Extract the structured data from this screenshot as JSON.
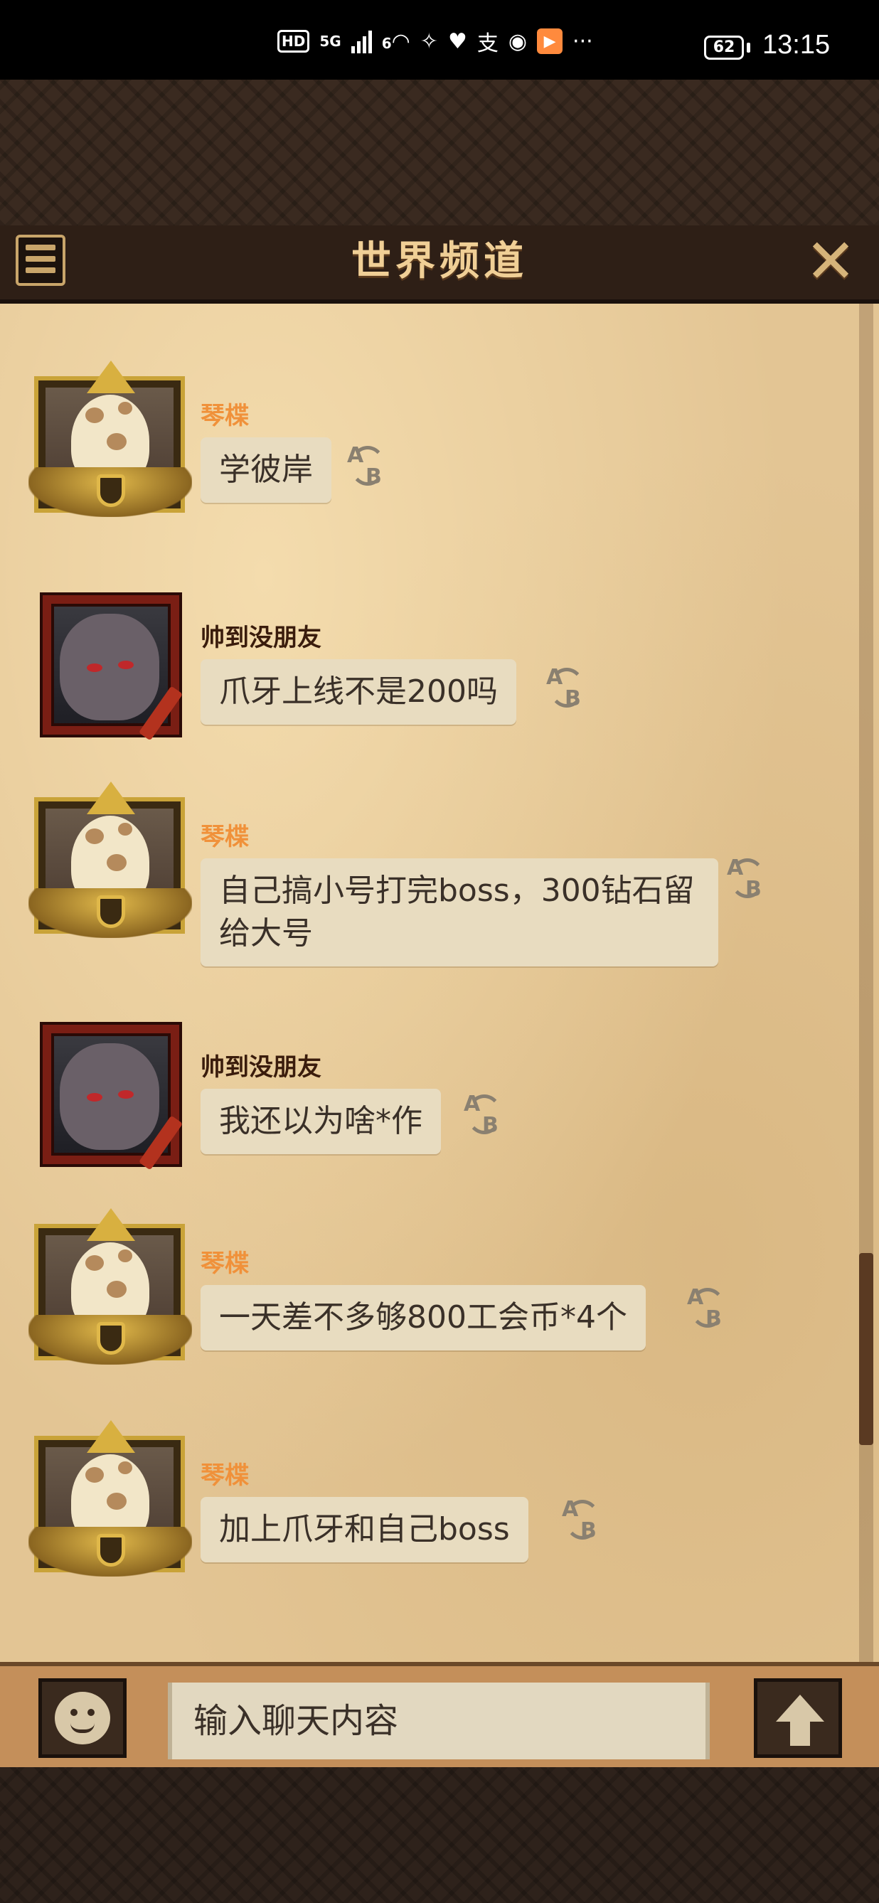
{
  "status_bar": {
    "hd": "HD",
    "network": "5G",
    "wifi_badge": "6",
    "battery": "62",
    "time": "13:15",
    "more": "···"
  },
  "header": {
    "title": "世界频道"
  },
  "messages": [
    {
      "sender": "琴楪",
      "avatar": "gold-frame-avatar",
      "text": "学彼岸"
    },
    {
      "sender": "帅到没朋友",
      "avatar": "red-frame-avatar",
      "text": "爪牙上线不是200吗"
    },
    {
      "sender": "琴楪",
      "avatar": "gold-frame-avatar",
      "text": "自己搞小号打完boss，300钻石留给大号"
    },
    {
      "sender": "帅到没朋友",
      "avatar": "red-frame-avatar",
      "text": "我还以为啥*作"
    },
    {
      "sender": "琴楪",
      "avatar": "gold-frame-avatar",
      "text": "一天差不多够800工会币*4个"
    },
    {
      "sender": "琴楪",
      "avatar": "gold-frame-avatar",
      "text": "加上爪牙和自己boss"
    }
  ],
  "input": {
    "placeholder": "输入聊天内容"
  },
  "translate_icon": {
    "a": "A",
    "b": "B"
  },
  "colors": {
    "name_vip": "#f0913a",
    "name_normal": "#3a1c0c",
    "parchment": "#e3c594",
    "bubble": "#e8dcc0"
  }
}
